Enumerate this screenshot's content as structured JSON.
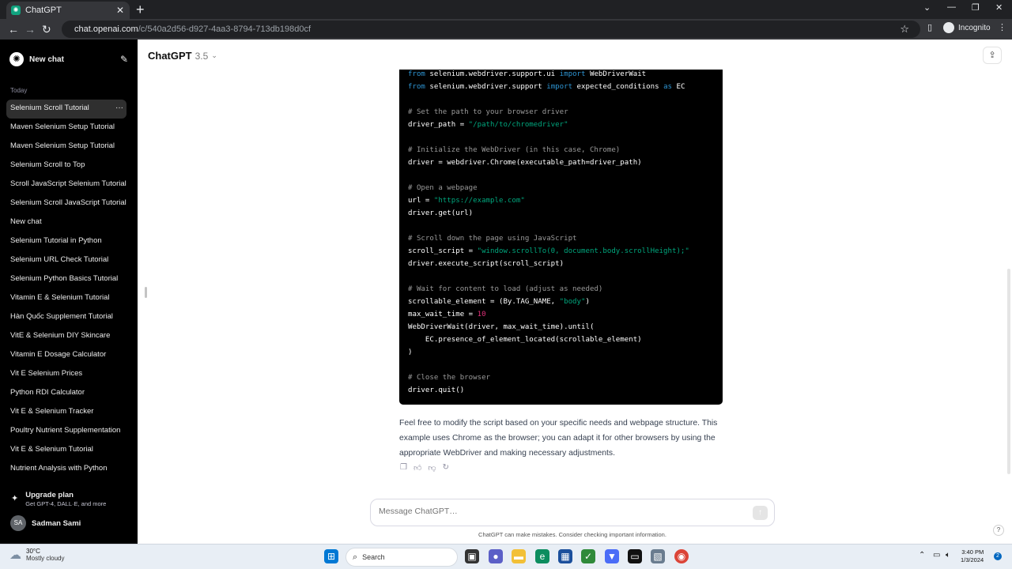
{
  "browser": {
    "tab_title": "ChatGPT",
    "tab_close": "✕",
    "new_tab": "+",
    "url_host": "chat.openai.com",
    "url_path": "/c/540a2d56-d927-4aa3-8794-713db198d0cf",
    "incognito_label": "Incognito"
  },
  "sidebar": {
    "new_chat_label": "New chat",
    "section_today": "Today",
    "history": [
      "Selenium Scroll Tutorial",
      "Maven Selenium Setup Tutorial",
      "Maven Selenium Setup Tutorial",
      "Selenium Scroll to Top",
      "Scroll JavaScript Selenium Tutorial",
      "Selenium Scroll JavaScript Tutorial",
      "New chat",
      "Selenium Tutorial in Python",
      "Selenium URL Check Tutorial",
      "Selenium Python Basics Tutorial",
      "Vitamin E & Selenium Tutorial",
      "Hàn Quốc Supplement Tutorial",
      "VitE & Selenium DIY Skincare",
      "Vitamin E Dosage Calculator",
      "Vit E Selenium Prices",
      "Python RDI Calculator",
      "Vit E & Selenium Tracker",
      "Poultry Nutrient Supplementation",
      "Vit E & Selenium Tutorial",
      "Nutrient Analysis with Python"
    ],
    "active_dots": "···",
    "upgrade_title": "Upgrade plan",
    "upgrade_sub": "Get GPT-4, DALL·E, and more",
    "user_initials": "SA",
    "user_name": "Sadman Sami"
  },
  "header": {
    "model_name": "ChatGPT",
    "model_version": "3.5"
  },
  "code_lines": [
    [
      {
        "t": "from",
        "c": "kw"
      },
      {
        "t": " selenium.webdriver.support.ui "
      },
      {
        "t": "import",
        "c": "kw"
      },
      {
        "t": " WebDriverWait"
      }
    ],
    [
      {
        "t": "from",
        "c": "kw"
      },
      {
        "t": " selenium.webdriver.support "
      },
      {
        "t": "import",
        "c": "kw"
      },
      {
        "t": " expected_conditions "
      },
      {
        "t": "as",
        "c": "kw"
      },
      {
        "t": " EC"
      }
    ],
    [],
    [
      {
        "t": "# Set the path to your browser driver",
        "c": "cmt"
      }
    ],
    [
      {
        "t": "driver_path = "
      },
      {
        "t": "\"/path/to/chromedriver\"",
        "c": "str"
      }
    ],
    [],
    [
      {
        "t": "# Initialize the WebDriver (in this case, Chrome)",
        "c": "cmt"
      }
    ],
    [
      {
        "t": "driver = webdriver.Chrome(executable_path=driver_path)"
      }
    ],
    [],
    [
      {
        "t": "# Open a webpage",
        "c": "cmt"
      }
    ],
    [
      {
        "t": "url = "
      },
      {
        "t": "\"https://example.com\"",
        "c": "str"
      }
    ],
    [
      {
        "t": "driver.get(url)"
      }
    ],
    [],
    [
      {
        "t": "# Scroll down the page using JavaScript",
        "c": "cmt"
      }
    ],
    [
      {
        "t": "scroll_script = "
      },
      {
        "t": "\"window.scrollTo(0, document.body.scrollHeight);\"",
        "c": "str"
      }
    ],
    [
      {
        "t": "driver.execute_script(scroll_script)"
      }
    ],
    [],
    [
      {
        "t": "# Wait for content to load (adjust as needed)",
        "c": "cmt"
      }
    ],
    [
      {
        "t": "scrollable_element = (By.TAG_NAME, "
      },
      {
        "t": "\"body\"",
        "c": "str"
      },
      {
        "t": ")"
      }
    ],
    [
      {
        "t": "max_wait_time = "
      },
      {
        "t": "10",
        "c": "num"
      }
    ],
    [
      {
        "t": "WebDriverWait(driver, max_wait_time).until("
      }
    ],
    [
      {
        "t": "    EC.presence_of_element_located(scrollable_element)"
      }
    ],
    [
      {
        "t": ")"
      }
    ],
    [],
    [
      {
        "t": "# Close the browser",
        "c": "cmt"
      }
    ],
    [
      {
        "t": "driver.quit()"
      }
    ]
  ],
  "reply_text": "Feel free to modify the script based on your specific needs and webpage structure. This example uses Chrome as the browser; you can adapt it for other browsers by using the appropriate WebDriver and making necessary adjustments.",
  "composer": {
    "placeholder": "Message ChatGPT…",
    "disclaimer": "ChatGPT can make mistakes. Consider checking important information.",
    "help": "?"
  },
  "taskbar": {
    "weather_temp": "30°C",
    "weather_desc": "Mostly cloudy",
    "search_label": "Search",
    "time": "3:40 PM",
    "date": "1/3/2024",
    "notifications": "2"
  }
}
